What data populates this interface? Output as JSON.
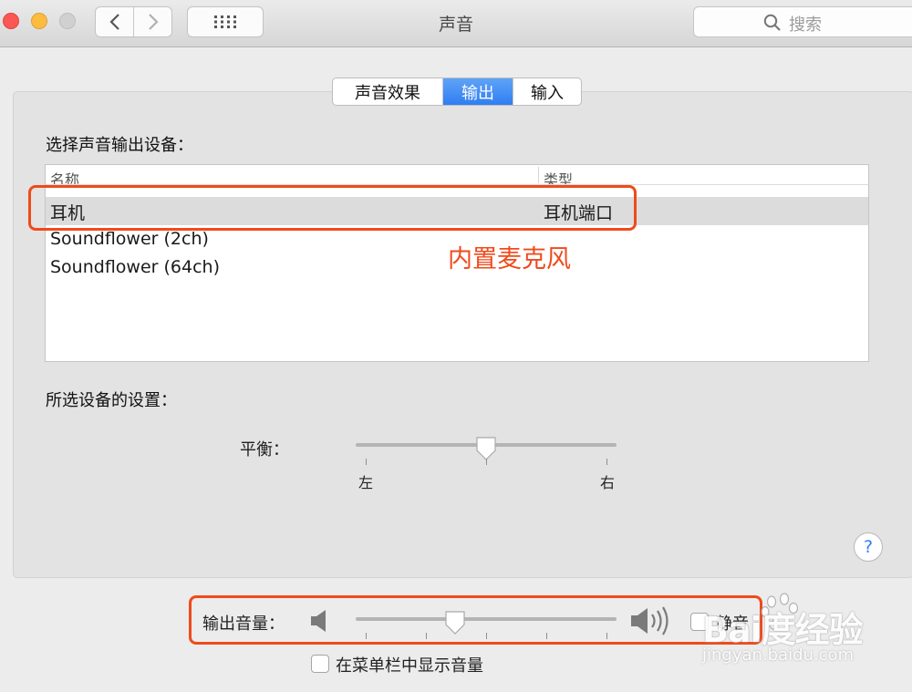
{
  "window": {
    "title": "声音",
    "search_placeholder": "搜索"
  },
  "tabs": [
    {
      "label": "声音效果",
      "active": false
    },
    {
      "label": "输出",
      "active": true
    },
    {
      "label": "输入",
      "active": false
    }
  ],
  "output": {
    "select_heading": "选择声音输出设备：",
    "columns": {
      "name": "名称",
      "type": "类型"
    },
    "devices": [
      {
        "name": "耳机",
        "type": "耳机端口",
        "selected": true
      },
      {
        "name": "Soundflower (2ch)",
        "type": "",
        "selected": false
      },
      {
        "name": "Soundflower (64ch)",
        "type": "",
        "selected": false
      }
    ],
    "annotation": "内置麦克风",
    "settings_heading": "所选设备的设置：",
    "balance": {
      "label": "平衡：",
      "left": "左",
      "right": "右",
      "value": 0.5
    },
    "help": "?"
  },
  "volume": {
    "label": "输出音量：",
    "value": 0.38,
    "mute_label": "静音",
    "mute_checked": false,
    "show_in_menubar_label": "在菜单栏中显示音量",
    "show_in_menubar_checked": false
  },
  "watermark": {
    "brand": "Bai度经验",
    "url": "jingyan.baidu.com"
  },
  "colors": {
    "accent": "#2f7ef3",
    "annotation": "#f04a1c"
  }
}
